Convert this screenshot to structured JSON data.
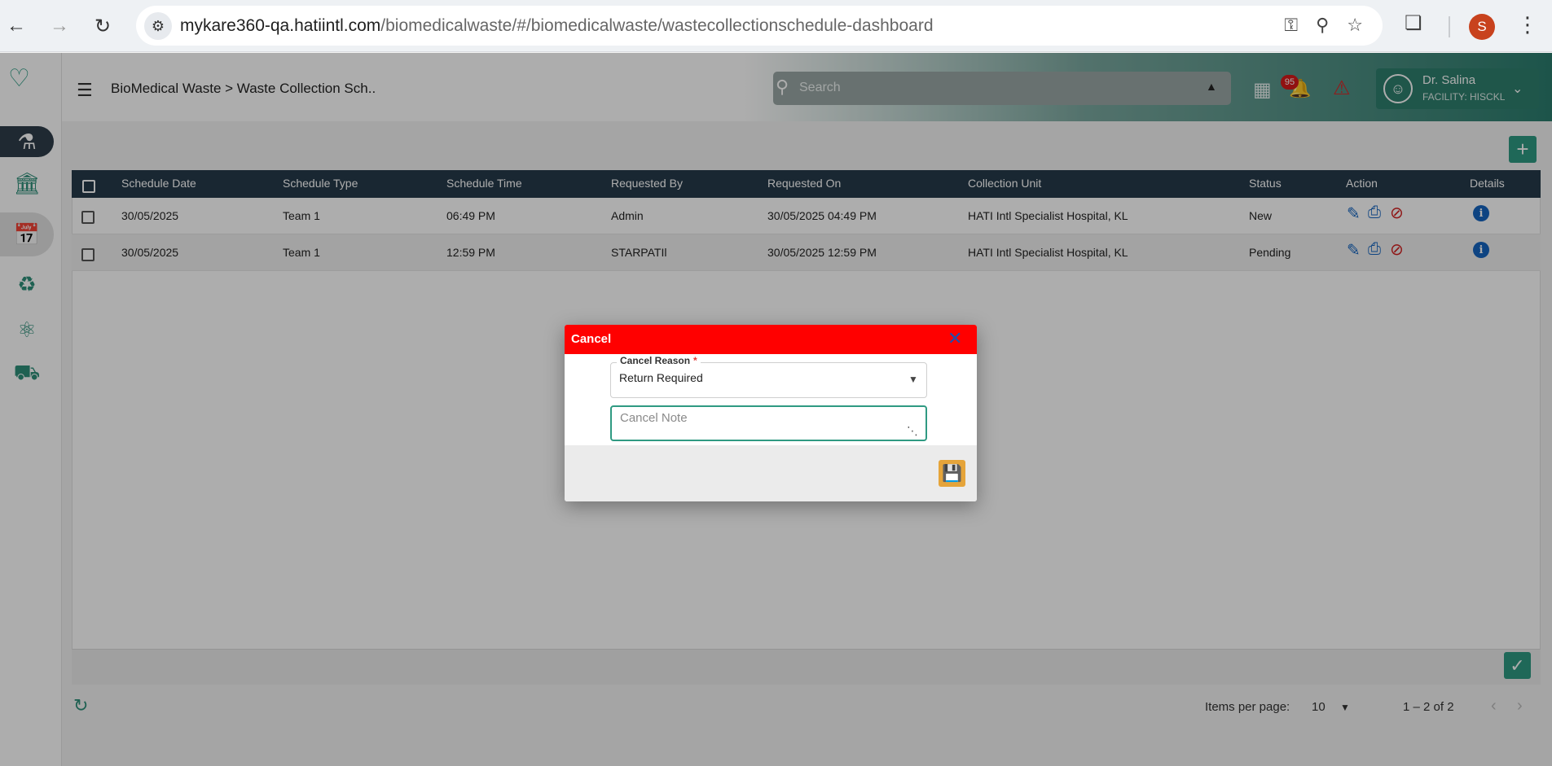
{
  "browser": {
    "url_host": "mykare360-qa.hatiintl.com",
    "url_path": "/biomedicalwaste/#/biomedicalwaste/wastecollectionschedule-dashboard",
    "profile_initial": "S"
  },
  "header": {
    "breadcrumb": "BioMedical Waste > Waste Collection Sch..",
    "search_placeholder": "Search",
    "notification_count": "95",
    "user_name": "Dr. Salina",
    "user_facility": "FACILITY: HISCKL"
  },
  "table": {
    "columns": [
      "Schedule Date",
      "Schedule Type",
      "Schedule Time",
      "Requested By",
      "Requested On",
      "Collection Unit",
      "Status",
      "Action",
      "Details"
    ],
    "rows": [
      {
        "date": "30/05/2025",
        "type": "Team 1",
        "time": "06:49 PM",
        "requested_by": "Admin",
        "requested_on": "30/05/2025 04:49 PM",
        "unit": "HATI Intl Specialist Hospital, KL",
        "status": "New"
      },
      {
        "date": "30/05/2025",
        "type": "Team 1",
        "time": "12:59 PM",
        "requested_by": "STARPATIl",
        "requested_on": "30/05/2025 12:59 PM",
        "unit": "HATI Intl Specialist Hospital, KL",
        "status": "Pending"
      }
    ]
  },
  "pagination": {
    "items_per_page_label": "Items per page:",
    "items_per_page": "10",
    "range": "1 – 2 of 2"
  },
  "modal": {
    "title": "Cancel",
    "reason_label": "Cancel Reason",
    "required_marker": "*",
    "reason_value": "Return Required",
    "note_placeholder": "Cancel Note"
  },
  "colors": {
    "modal_header": "#ff0000",
    "accent": "#2f9a82",
    "table_header": "#263a4a",
    "save_button": "#e5a43a"
  },
  "icons": [
    "back-icon",
    "forward-icon",
    "reload-icon",
    "site-settings-icon",
    "key-icon",
    "zoom-icon",
    "star-icon",
    "extensions-icon",
    "kebab-icon",
    "hamburger-icon",
    "search-icon",
    "apps-icon",
    "bell-icon",
    "alarm-icon",
    "user-icon",
    "add-icon",
    "edit-icon",
    "print-icon",
    "block-icon",
    "info-icon",
    "check-icon",
    "refresh-icon",
    "close-icon",
    "save-icon"
  ]
}
